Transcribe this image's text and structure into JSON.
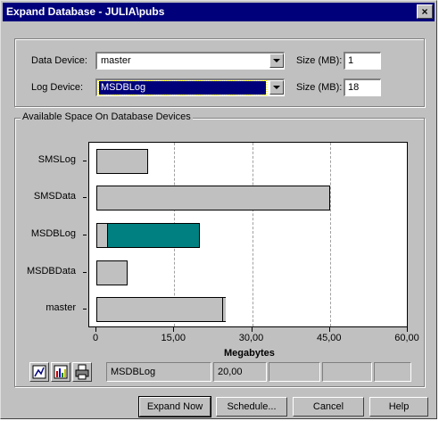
{
  "window": {
    "title": "Expand Database - JULIA\\pubs",
    "close_glyph": "×"
  },
  "form": {
    "data_device_label": "Data Device:",
    "data_device_value": "master",
    "data_size_label": "Size (MB):",
    "data_size_value": "1",
    "log_device_label": "Log Device:",
    "log_device_value": "MSDBLog",
    "log_size_label": "Size (MB):",
    "log_size_value": "18"
  },
  "group": {
    "label": "Available Space On Database Devices"
  },
  "chart_data": {
    "type": "bar",
    "orientation": "horizontal",
    "categories": [
      "SMSLog",
      "SMSData",
      "MSDBLog",
      "MSDBData",
      "master"
    ],
    "values": [
      10,
      45,
      20,
      6,
      25
    ],
    "highlight": {
      "category": "MSDBLog",
      "start": 2,
      "end": 20,
      "color": "#008080"
    },
    "xlabel": "Megabytes",
    "xlim": [
      0,
      60
    ],
    "xticks": [
      "0",
      "15,00",
      "30,00",
      "45,00",
      "60,00"
    ],
    "grid": true
  },
  "status": {
    "device": "MSDBLog",
    "value": "20,00"
  },
  "toolbar": {
    "icons": [
      "chart-type-icon",
      "bar-chart-icon",
      "print-icon"
    ]
  },
  "buttons": {
    "expand_now": "Expand Now",
    "schedule": "Schedule...",
    "cancel": "Cancel",
    "help": "Help"
  },
  "colors": {
    "titlebar": "#00007b",
    "highlight_bar": "#008080",
    "face": "#c0c0c0"
  }
}
